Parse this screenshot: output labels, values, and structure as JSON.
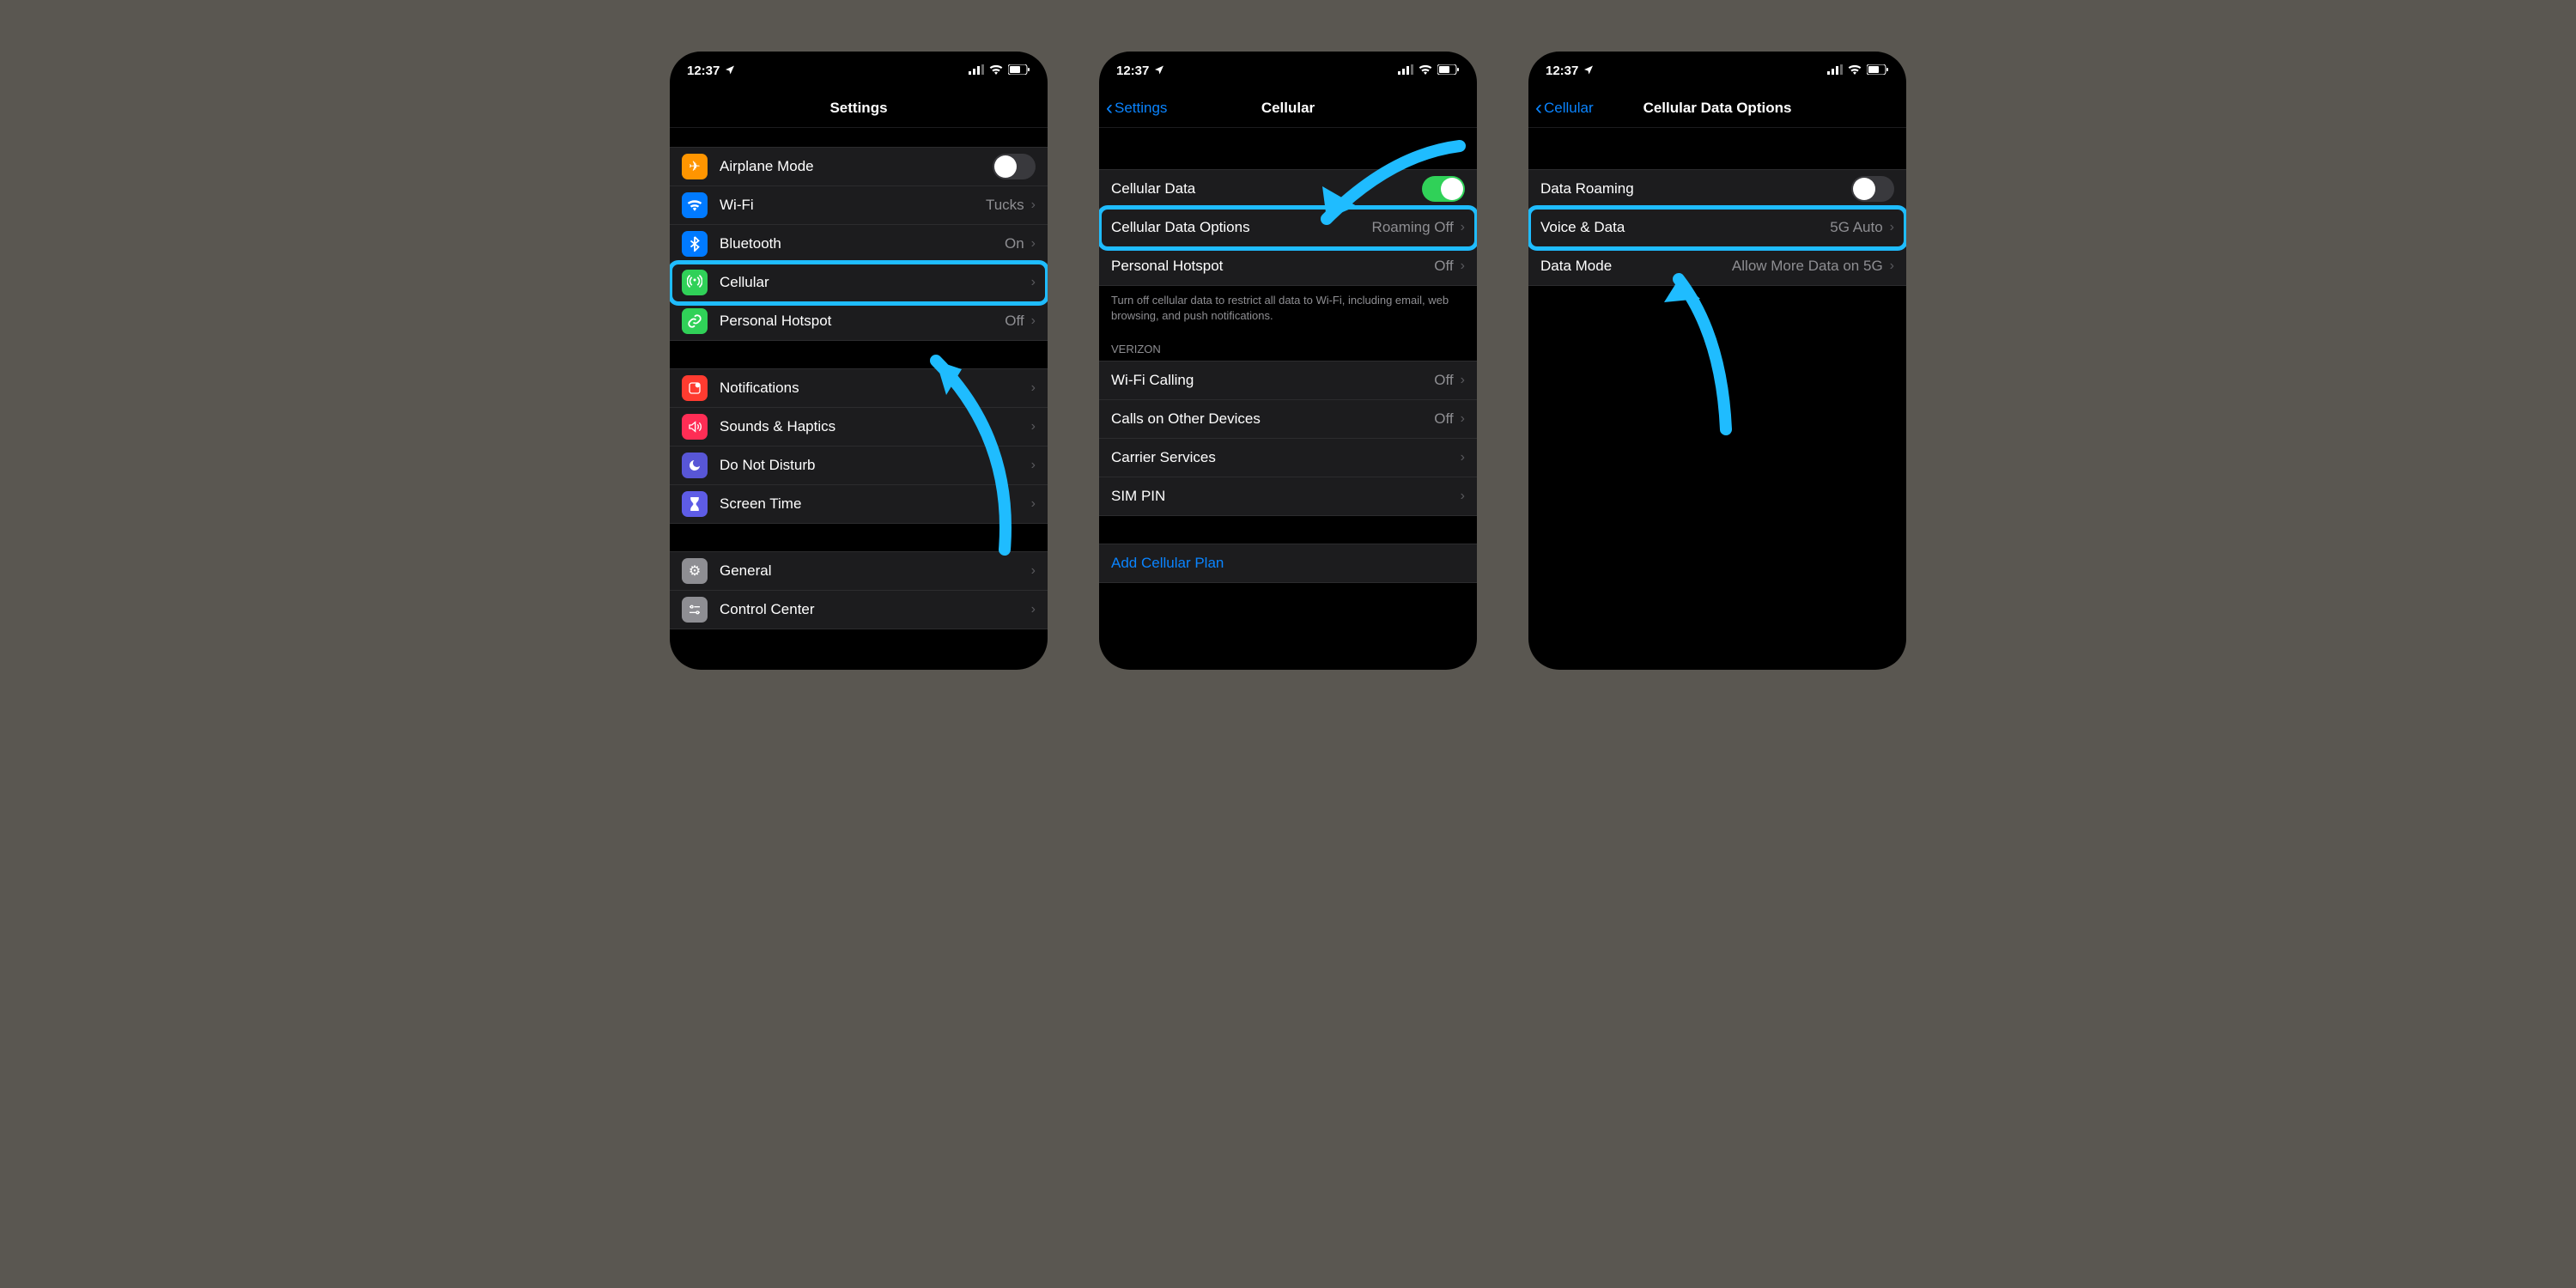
{
  "status": {
    "time": "12:37"
  },
  "screens": [
    {
      "title": "Settings",
      "back": null,
      "groups": [
        {
          "rows": [
            {
              "icon": "airplane",
              "iconColor": "bg-orange",
              "label": "Airplane Mode",
              "toggle": false,
              "type": "toggle"
            },
            {
              "icon": "wifi",
              "iconColor": "bg-blue",
              "label": "Wi-Fi",
              "value": "Tucks",
              "type": "nav"
            },
            {
              "icon": "bluetooth",
              "iconColor": "bg-blue",
              "label": "Bluetooth",
              "value": "On",
              "type": "nav"
            },
            {
              "icon": "antenna",
              "iconColor": "bg-green",
              "label": "Cellular",
              "type": "nav",
              "highlight": true
            },
            {
              "icon": "link",
              "iconColor": "bg-green",
              "label": "Personal Hotspot",
              "value": "Off",
              "type": "nav"
            }
          ]
        },
        {
          "rows": [
            {
              "icon": "bell",
              "iconColor": "bg-red",
              "label": "Notifications",
              "type": "nav"
            },
            {
              "icon": "speaker",
              "iconColor": "bg-red2",
              "label": "Sounds & Haptics",
              "type": "nav"
            },
            {
              "icon": "moon",
              "iconColor": "bg-purple",
              "label": "Do Not Disturb",
              "type": "nav"
            },
            {
              "icon": "hourglass",
              "iconColor": "bg-purple2",
              "label": "Screen Time",
              "type": "nav"
            }
          ]
        },
        {
          "rows": [
            {
              "icon": "gear",
              "iconColor": "bg-gray",
              "label": "General",
              "type": "nav"
            },
            {
              "icon": "sliders",
              "iconColor": "bg-gray",
              "label": "Control Center",
              "type": "nav"
            }
          ]
        }
      ]
    },
    {
      "title": "Cellular",
      "back": "Settings",
      "groups": [
        {
          "rows": [
            {
              "label": "Cellular Data",
              "toggle": true,
              "type": "toggle"
            },
            {
              "label": "Cellular Data Options",
              "value": "Roaming Off",
              "type": "nav",
              "highlight": true
            },
            {
              "label": "Personal Hotspot",
              "value": "Off",
              "type": "nav"
            }
          ],
          "footer": "Turn off cellular data to restrict all data to Wi-Fi, including email, web browsing, and push notifications."
        },
        {
          "header": "VERIZON",
          "rows": [
            {
              "label": "Wi-Fi Calling",
              "value": "Off",
              "type": "nav"
            },
            {
              "label": "Calls on Other Devices",
              "value": "Off",
              "type": "nav"
            },
            {
              "label": "Carrier Services",
              "type": "nav"
            },
            {
              "label": "SIM PIN",
              "type": "nav"
            }
          ]
        },
        {
          "rows": [
            {
              "label": "Add Cellular Plan",
              "type": "link"
            }
          ]
        }
      ]
    },
    {
      "title": "Cellular Data Options",
      "back": "Cellular",
      "groups": [
        {
          "rows": [
            {
              "label": "Data Roaming",
              "toggle": false,
              "type": "toggle"
            },
            {
              "label": "Voice & Data",
              "value": "5G Auto",
              "type": "nav",
              "highlight": true
            },
            {
              "label": "Data Mode",
              "value": "Allow More Data on 5G",
              "type": "nav"
            }
          ]
        }
      ]
    }
  ],
  "arrows_desc": "Three cyan curved arrows pointing to highlighted rows in each screen"
}
